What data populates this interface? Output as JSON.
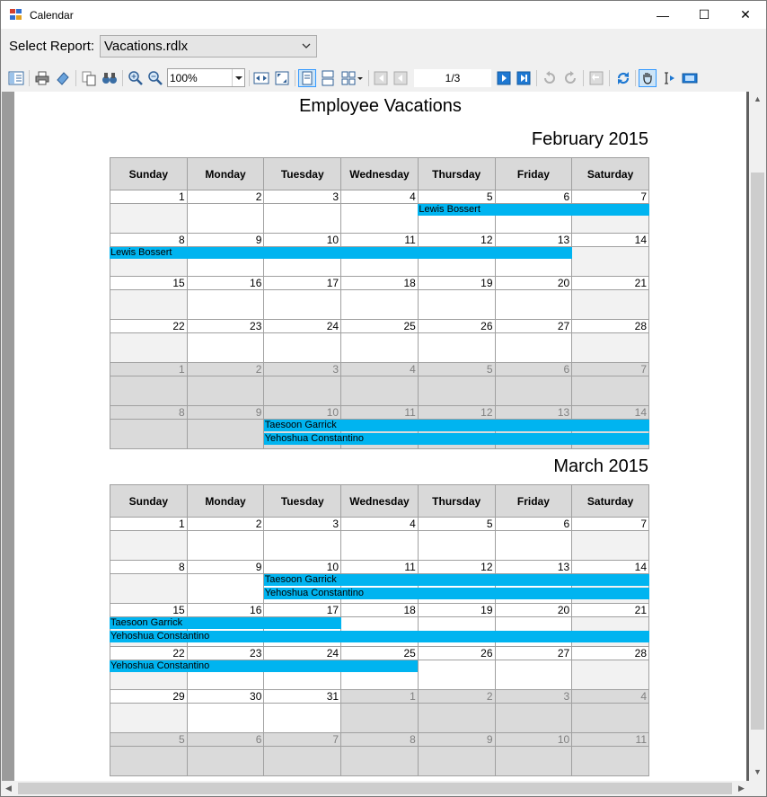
{
  "window": {
    "title": "Calendar",
    "minimize": "—",
    "maximize": "☐",
    "close": "✕"
  },
  "report_bar": {
    "label": "Select Report:",
    "selected": "Vacations.rdlx"
  },
  "toolbar": {
    "zoom": "100%",
    "page": "1/3"
  },
  "report": {
    "title": "Employee Vacations",
    "weekdays": [
      "Sunday",
      "Monday",
      "Tuesday",
      "Wednesday",
      "Thursday",
      "Friday",
      "Saturday"
    ],
    "months": [
      {
        "title": "February 2015",
        "weeks": [
          [
            {
              "d": "1"
            },
            {
              "d": "2"
            },
            {
              "d": "3"
            },
            {
              "d": "4"
            },
            {
              "d": "5"
            },
            {
              "d": "6"
            },
            {
              "d": "7"
            }
          ],
          [
            {
              "d": "8"
            },
            {
              "d": "9"
            },
            {
              "d": "10"
            },
            {
              "d": "11"
            },
            {
              "d": "12"
            },
            {
              "d": "13"
            },
            {
              "d": "14"
            }
          ],
          [
            {
              "d": "15"
            },
            {
              "d": "16"
            },
            {
              "d": "17"
            },
            {
              "d": "18"
            },
            {
              "d": "19"
            },
            {
              "d": "20"
            },
            {
              "d": "21"
            }
          ],
          [
            {
              "d": "22"
            },
            {
              "d": "23"
            },
            {
              "d": "24"
            },
            {
              "d": "25"
            },
            {
              "d": "26"
            },
            {
              "d": "27"
            },
            {
              "d": "28"
            }
          ],
          [
            {
              "d": "1",
              "o": 1
            },
            {
              "d": "2",
              "o": 1
            },
            {
              "d": "3",
              "o": 1
            },
            {
              "d": "4",
              "o": 1
            },
            {
              "d": "5",
              "o": 1
            },
            {
              "d": "6",
              "o": 1
            },
            {
              "d": "7",
              "o": 1
            }
          ],
          [
            {
              "d": "8",
              "o": 1
            },
            {
              "d": "9",
              "o": 1
            },
            {
              "d": "10",
              "o": 1
            },
            {
              "d": "11",
              "o": 1
            },
            {
              "d": "12",
              "o": 1
            },
            {
              "d": "13",
              "o": 1
            },
            {
              "d": "14",
              "o": 1
            }
          ]
        ],
        "events": [
          {
            "name": "Lewis Bossert",
            "week": 0,
            "start": 4,
            "end": 6,
            "lane": 0
          },
          {
            "name": "Lewis Bossert",
            "week": 1,
            "start": 0,
            "end": 5,
            "lane": 0
          },
          {
            "name": "Taesoon Garrick",
            "week": 5,
            "start": 2,
            "end": 6,
            "lane": 0
          },
          {
            "name": "Yehoshua Constantino",
            "week": 5,
            "start": 2,
            "end": 6,
            "lane": 1
          }
        ]
      },
      {
        "title": "March 2015",
        "weeks": [
          [
            {
              "d": "1"
            },
            {
              "d": "2"
            },
            {
              "d": "3"
            },
            {
              "d": "4"
            },
            {
              "d": "5"
            },
            {
              "d": "6"
            },
            {
              "d": "7"
            }
          ],
          [
            {
              "d": "8"
            },
            {
              "d": "9"
            },
            {
              "d": "10"
            },
            {
              "d": "11"
            },
            {
              "d": "12"
            },
            {
              "d": "13"
            },
            {
              "d": "14"
            }
          ],
          [
            {
              "d": "15"
            },
            {
              "d": "16"
            },
            {
              "d": "17"
            },
            {
              "d": "18"
            },
            {
              "d": "19"
            },
            {
              "d": "20"
            },
            {
              "d": "21"
            }
          ],
          [
            {
              "d": "22"
            },
            {
              "d": "23"
            },
            {
              "d": "24"
            },
            {
              "d": "25"
            },
            {
              "d": "26"
            },
            {
              "d": "27"
            },
            {
              "d": "28"
            }
          ],
          [
            {
              "d": "29"
            },
            {
              "d": "30"
            },
            {
              "d": "31"
            },
            {
              "d": "1",
              "o": 1
            },
            {
              "d": "2",
              "o": 1
            },
            {
              "d": "3",
              "o": 1
            },
            {
              "d": "4",
              "o": 1
            }
          ],
          [
            {
              "d": "5",
              "o": 1
            },
            {
              "d": "6",
              "o": 1
            },
            {
              "d": "7",
              "o": 1
            },
            {
              "d": "8",
              "o": 1
            },
            {
              "d": "9",
              "o": 1
            },
            {
              "d": "10",
              "o": 1
            },
            {
              "d": "11",
              "o": 1
            }
          ]
        ],
        "events": [
          {
            "name": "Taesoon Garrick",
            "week": 1,
            "start": 2,
            "end": 6,
            "lane": 0
          },
          {
            "name": "Yehoshua Constantino",
            "week": 1,
            "start": 2,
            "end": 6,
            "lane": 1
          },
          {
            "name": "Taesoon Garrick",
            "week": 2,
            "start": 0,
            "end": 2,
            "lane": 0
          },
          {
            "name": "Yehoshua Constantino",
            "week": 2,
            "start": 0,
            "end": 6,
            "lane": 1
          },
          {
            "name": "Yehoshua Constantino",
            "week": 3,
            "start": 0,
            "end": 3,
            "lane": 0
          }
        ]
      }
    ]
  },
  "colors": {
    "event_bar": "#00b4f0",
    "header_fill": "#d9d9d9",
    "other_month_fill": "#dadada"
  }
}
